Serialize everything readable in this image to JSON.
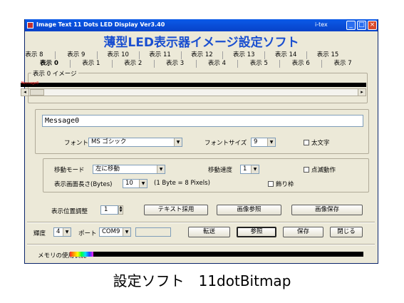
{
  "window": {
    "title": "Image Text 11 Dots LED Display Ver3.40",
    "company": "i-tex",
    "minimize": "_",
    "maximize": "□",
    "close": "×"
  },
  "heading": "薄型LED表示器イメージ設定ソフト",
  "tabs_top": [
    "表示 8",
    "表示 9",
    "表示 10",
    "表示 11",
    "表示 12",
    "表示 13",
    "表示 14",
    "表示 15"
  ],
  "tabs_bottom": [
    "表示 0",
    "表示 1",
    "表示 2",
    "表示 3",
    "表示 4",
    "表示 5",
    "表示 6",
    "表示 7"
  ],
  "active_tab": "表示 0",
  "image_group": {
    "label": "表示 0 イメージ",
    "led_text": "Message0",
    "scroll_left": "◂",
    "scroll_right": "▸"
  },
  "message": {
    "value": "Message0"
  },
  "font": {
    "label": "フォント",
    "value": "MS ゴシック",
    "size_label": "フォントサイズ",
    "size_value": "9",
    "bold_label": "太文字"
  },
  "motion": {
    "mode_label": "移動モード",
    "mode_value": "左に移動",
    "speed_label": "移動速度",
    "speed_value": "1",
    "blink_label": "点滅動作",
    "length_label": "表示画面長さ(Bytes)",
    "length_value": "10",
    "length_note": "(1 Byte = 8 Pixels)",
    "border_label": "飾り枠"
  },
  "position": {
    "label": "表示位置調整",
    "value": "1",
    "adopt_text_button": "テキスト採用",
    "browse_image_button": "画像参照",
    "save_image_button": "画像保存"
  },
  "bottom": {
    "brightness_label": "輝度",
    "brightness_value": "4",
    "port_label": "ポート",
    "port_value": "COM9",
    "transfer_button": "転送",
    "browse_button": "参照",
    "save_button": "保存",
    "close_button": "閉じる",
    "memory_label": "メモリの使用状況",
    "memory_usage": 0.08
  },
  "caption": "設定ソフト　11dotBitmap",
  "colors": {
    "heading": "#1a4fd0",
    "titlebar": "#0a5ae8",
    "dialog_bg": "#ece9d8",
    "led_text": "#ff2020"
  }
}
